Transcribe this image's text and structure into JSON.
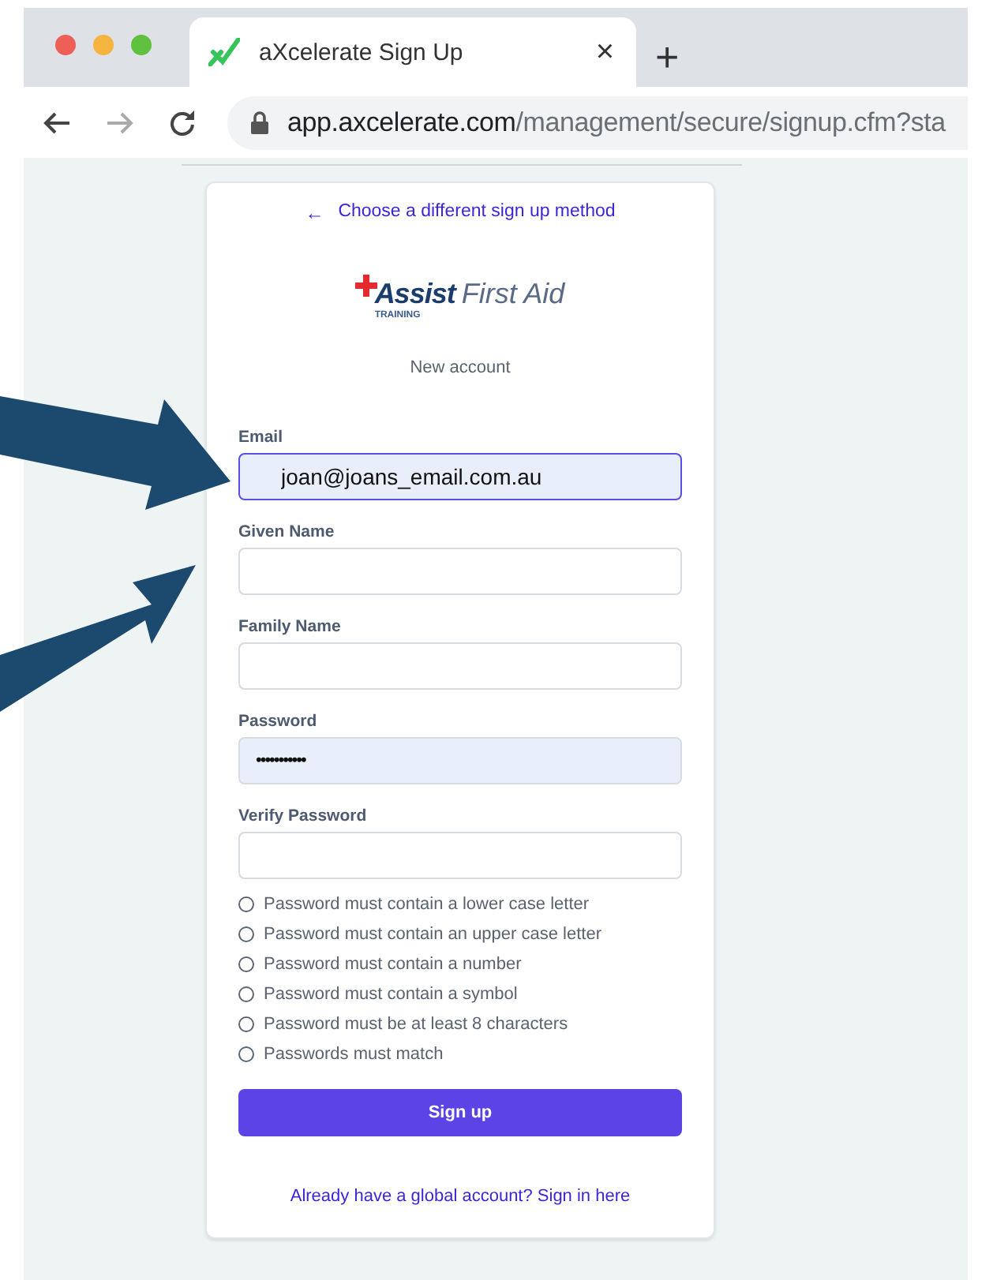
{
  "browser": {
    "tab": {
      "title": "aXcelerate Sign Up",
      "close": "×",
      "selected": true
    },
    "new_tab": "+",
    "address": {
      "host": "app.axcelerate.com",
      "path": "/management/secure/signup.cfm?sta"
    }
  },
  "form": {
    "back_link": {
      "arrow": "←",
      "text": "Choose a different sign up method"
    },
    "logo": {
      "bold": "Assist",
      "rest": "First Aid",
      "sub": "TRAINING"
    },
    "heading": "New account",
    "fields": [
      {
        "label": "Email",
        "kind": "text",
        "value": "joan@joans_email.com.au",
        "autofilled": true,
        "focused": true
      },
      {
        "label": "Given Name",
        "kind": "text",
        "autofilled": false,
        "focused": false
      },
      {
        "label": "Family Name",
        "kind": "text",
        "autofilled": false,
        "focused": false
      },
      {
        "label": "Password",
        "kind": "password",
        "value": "•••••••••••",
        "autofilled": true,
        "focused": false
      },
      {
        "label": "Verify Password",
        "kind": "password",
        "autofilled": false,
        "focused": false
      }
    ],
    "requirements": [
      {
        "text": "Password must contain a lower case letter",
        "met": false
      },
      {
        "text": "Password must contain an upper case letter",
        "met": false
      },
      {
        "text": "Password must contain a number",
        "met": false
      },
      {
        "text": "Password must contain a symbol",
        "met": false
      },
      {
        "text": "Password must be at least 8 characters",
        "met": false
      },
      {
        "text": "Passwords must match",
        "met": false
      }
    ],
    "submit": "Sign up",
    "footer_link": "Already have a global account? Sign in here"
  }
}
